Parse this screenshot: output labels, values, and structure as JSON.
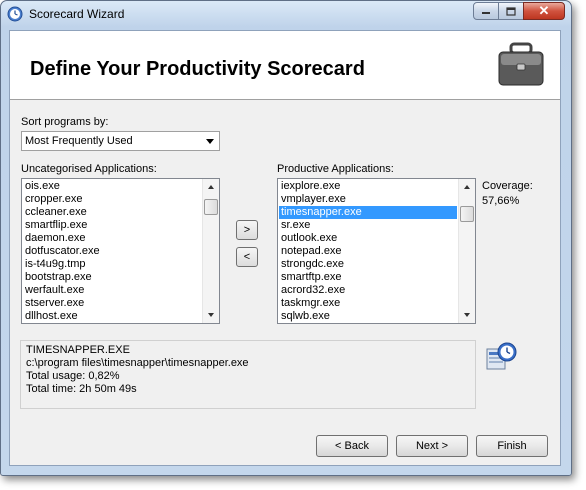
{
  "window": {
    "title": "Scorecard Wizard"
  },
  "header": {
    "title": "Define Your Productivity Scorecard"
  },
  "sort": {
    "label": "Sort programs by:",
    "selected": "Most Frequently Used"
  },
  "uncategorised": {
    "label": "Uncategorised Applications:",
    "items": [
      "ois.exe",
      "cropper.exe",
      "ccleaner.exe",
      "smartflip.exe",
      "daemon.exe",
      "dotfuscator.exe",
      "is-t4u9g.tmp",
      "bootstrap.exe",
      "werfault.exe",
      "stserver.exe",
      "dllhost.exe"
    ]
  },
  "productive": {
    "label": "Productive Applications:",
    "items": [
      "iexplore.exe",
      "vmplayer.exe",
      "timesnapper.exe",
      "sr.exe",
      "outlook.exe",
      "notepad.exe",
      "strongdc.exe",
      "smartftp.exe",
      "acrord32.exe",
      "taskmgr.exe",
      "sqlwb.exe"
    ],
    "selected_index": 2
  },
  "coverage": {
    "label": "Coverage:",
    "value": "57,66%"
  },
  "move": {
    "right_label": ">",
    "left_label": "<"
  },
  "details": {
    "name": "TIMESNAPPER.EXE",
    "path": "c:\\program files\\timesnapper\\timesnapper.exe",
    "usage": "Total usage: 0,82%",
    "time": "Total time: 2h 50m 49s"
  },
  "buttons": {
    "back": "< Back",
    "next": "Next >",
    "finish": "Finish"
  },
  "icons": {
    "app": "clock-icon",
    "header": "briefcase-icon",
    "details": "timesnapper-icon"
  }
}
